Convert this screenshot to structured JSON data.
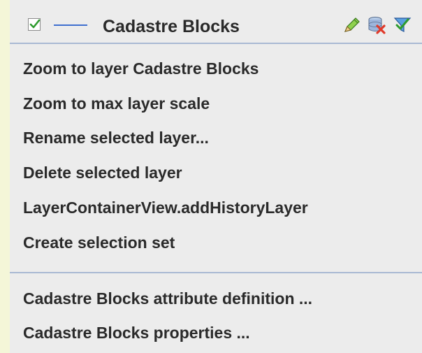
{
  "layer": {
    "name": "Cadastre Blocks",
    "visible_checkbox_icon": "checkmark-icon",
    "line_color": "#3f6fcf",
    "tools": [
      "edit-pencil-icon",
      "delete-database-icon",
      "filter-funnel-icon"
    ]
  },
  "menu": {
    "items": [
      "Zoom to layer Cadastre Blocks",
      "Zoom to max layer scale",
      "Rename selected layer...",
      "Delete selected layer",
      "LayerContainerView.addHistoryLayer",
      "Create selection set"
    ],
    "items2": [
      "Cadastre Blocks  attribute definition ...",
      "Cadastre Blocks properties ..."
    ]
  },
  "colors": {
    "separator": "#a9b9d3",
    "menu_bg": "#ececec",
    "text": "#2a2a2a"
  }
}
